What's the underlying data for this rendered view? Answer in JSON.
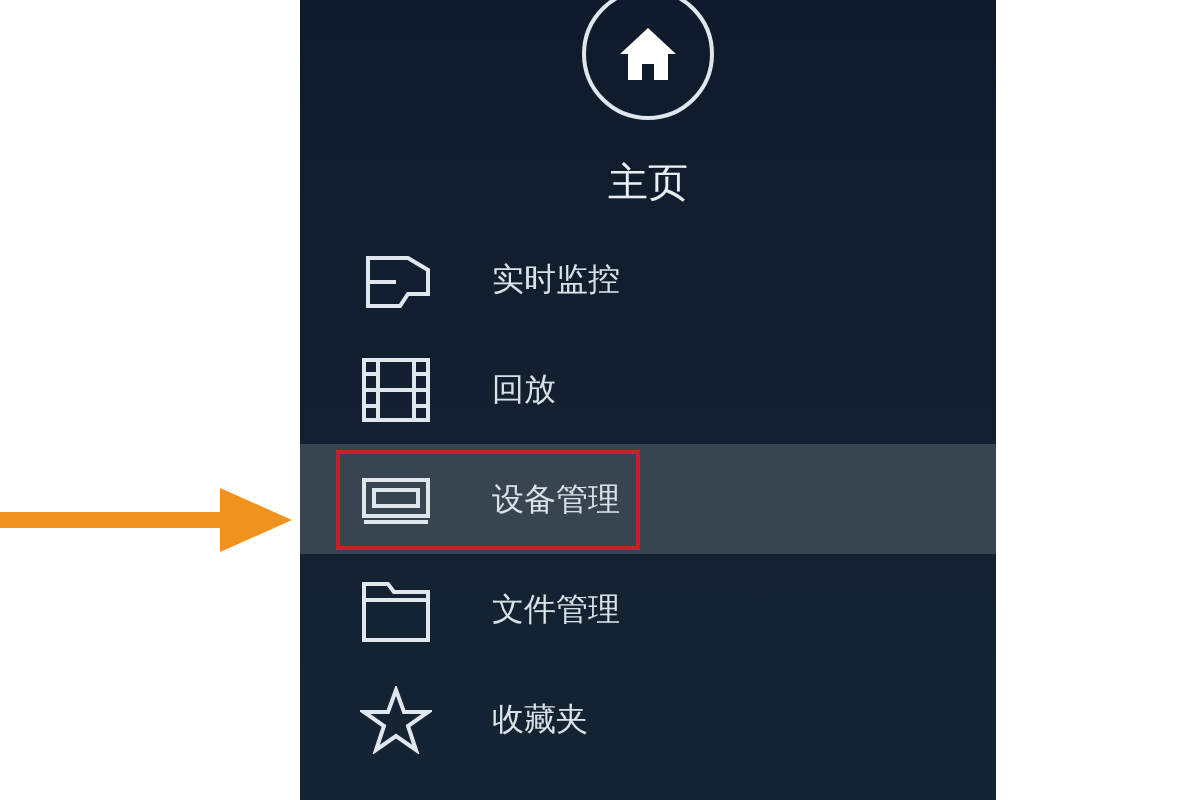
{
  "header": {
    "title": "主页"
  },
  "menu": [
    {
      "label": "实时监控",
      "selected": false,
      "outlined": false
    },
    {
      "label": "回放",
      "selected": false,
      "outlined": false
    },
    {
      "label": "设备管理",
      "selected": true,
      "outlined": true
    },
    {
      "label": "文件管理",
      "selected": false,
      "outlined": false
    },
    {
      "label": "收藏夹",
      "selected": false,
      "outlined": false
    }
  ]
}
